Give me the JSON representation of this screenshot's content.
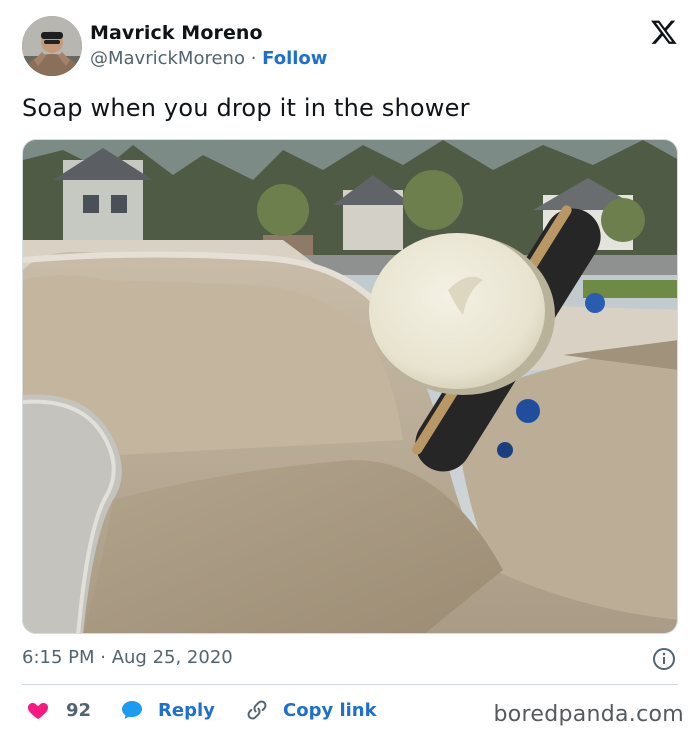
{
  "author": {
    "name": "Mavrick Moreno",
    "handle": "@MavrickMoreno",
    "separator": " · ",
    "follow_label": "Follow"
  },
  "tweet": {
    "text": "Soap when you drop it in the shower",
    "time": "6:15 PM",
    "date_separator": " · ",
    "date": "Aug 25, 2020"
  },
  "actions": {
    "likes_count": "92",
    "reply_label": "Reply",
    "copy_link_label": "Copy link"
  },
  "watermark": "boredpanda.com",
  "icons": {
    "logo": "x-logo-icon",
    "info": "info-icon",
    "like": "heart-icon",
    "reply": "speech-bubble-icon",
    "copy": "link-icon"
  },
  "colors": {
    "heart": "#f91880",
    "link_blue": "#1d6fd1",
    "muted_text": "#536471",
    "text": "#0f1419"
  }
}
